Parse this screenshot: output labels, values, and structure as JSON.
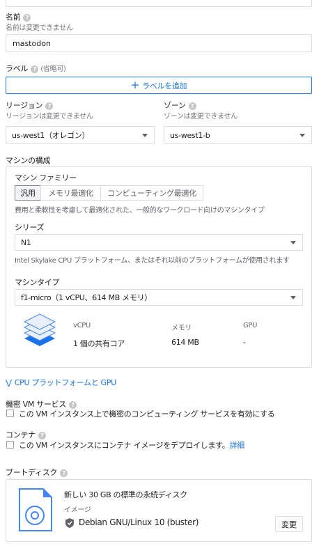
{
  "name": {
    "label": "名前",
    "sub": "名前は変更できません",
    "value": "mastodon"
  },
  "labels": {
    "label": "ラベル",
    "optional": "(省略可)",
    "add_button": "ラベルを追加"
  },
  "region": {
    "label": "リージョン",
    "sub": "リージョンは変更できません",
    "value": "us-west1（オレゴン）"
  },
  "zone": {
    "label": "ゾーン",
    "sub": "ゾーンは変更できません",
    "value": "us-west1-b"
  },
  "machine_config": {
    "title": "マシンの構成",
    "family_label": "マシン ファミリー",
    "tabs": [
      "汎用",
      "メモリ最適化",
      "コンピューティング最適化"
    ],
    "family_desc": "費用と柔軟性を考慮して最適化された、一般的なワークロード向けのマシンタイプ",
    "series_label": "シリーズ",
    "series_value": "N1",
    "series_desc": "Intel Skylake CPU プラットフォーム、またはそれ以前のプラットフォームが使用されます",
    "type_label": "マシンタイプ",
    "type_value": "f1-micro（1 vCPU、614 MB メモリ）",
    "specs": {
      "headers": [
        "vCPU",
        "メモリ",
        "GPU"
      ],
      "values": [
        "1 個の共有コア",
        "614 MB",
        "-"
      ]
    }
  },
  "cpu_platform_link": "CPU プラットフォームと GPU",
  "confidential": {
    "label": "機密 VM サービス",
    "checkbox": "この VM インスタンス上で機密のコンピューティング サービスを有効にする"
  },
  "container": {
    "label": "コンテナ",
    "checkbox": "この VM インスタンスにコンテナ イメージをデプロイします。",
    "link": "詳細"
  },
  "boot_disk": {
    "label": "ブートディスク",
    "title": "新しい 30 GB の標準の永続ディスク",
    "image_label": "イメージ",
    "image_value": "Debian GNU/Linux 10 (buster)",
    "change_button": "変更"
  },
  "colors": {
    "accent": "#1a73e8",
    "text": "#202124",
    "secondary": "#70757a",
    "border": "#dadce0",
    "disk_icon": "#4285f4"
  }
}
